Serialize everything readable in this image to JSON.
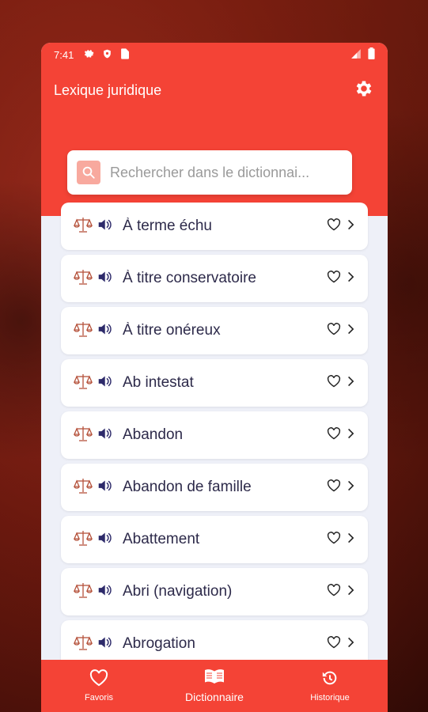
{
  "status_bar": {
    "time": "7:41",
    "icons": [
      "gear-icon",
      "shield-icon",
      "sim-icon"
    ],
    "right_icons": [
      "signal-icon",
      "battery-icon"
    ]
  },
  "app": {
    "title": "Lexique juridique",
    "settings_icon": "gear-icon",
    "accent_color": "#f44336"
  },
  "search": {
    "placeholder": "Rechercher dans le dictionnai..."
  },
  "terms": [
    {
      "label": "À terme échu"
    },
    {
      "label": "À titre conservatoire"
    },
    {
      "label": "À titre onéreux"
    },
    {
      "label": "Ab intestat"
    },
    {
      "label": "Abandon"
    },
    {
      "label": "Abandon de famille"
    },
    {
      "label": "Abattement"
    },
    {
      "label": "Abri (navigation)"
    },
    {
      "label": "Abrogation"
    }
  ],
  "bottom_nav": {
    "items": [
      {
        "label": "Favoris",
        "icon": "heart-icon"
      },
      {
        "label": "Dictionnaire",
        "icon": "book-icon",
        "active": true
      },
      {
        "label": "Historique",
        "icon": "history-icon"
      }
    ]
  }
}
